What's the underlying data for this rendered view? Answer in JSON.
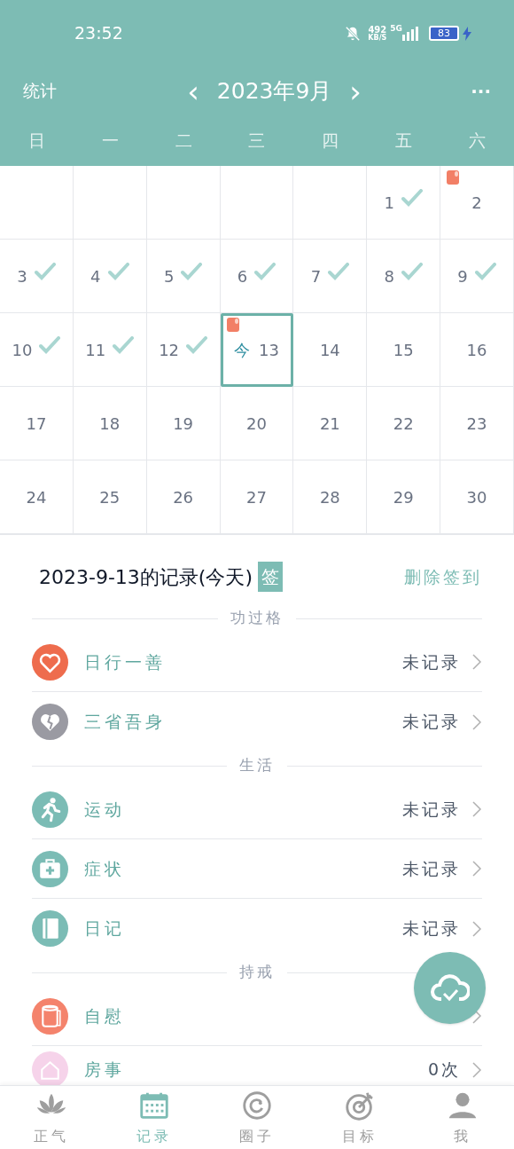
{
  "status_bar": {
    "time": "23:52",
    "speed": "492",
    "speed_unit": "KB/S",
    "network": "5G",
    "battery": "83"
  },
  "header": {
    "left": "统计",
    "prev": "‹",
    "title": "2023年9月",
    "next": "›",
    "more": "···"
  },
  "weekdays": [
    "日",
    "一",
    "二",
    "三",
    "四",
    "五",
    "六"
  ],
  "calendar": {
    "weeks": [
      [
        {
          "kind": "blank"
        },
        {
          "kind": "blank"
        },
        {
          "kind": "blank"
        },
        {
          "kind": "blank"
        },
        {
          "kind": "blank"
        },
        {
          "kind": "day",
          "day": "1",
          "checked": true,
          "marker": false,
          "selected": false
        },
        {
          "kind": "day",
          "day": "2",
          "checked": false,
          "marker": true,
          "selected": false
        }
      ],
      [
        {
          "kind": "day",
          "day": "3",
          "checked": true,
          "marker": false,
          "selected": false
        },
        {
          "kind": "day",
          "day": "4",
          "checked": true,
          "marker": false,
          "selected": false
        },
        {
          "kind": "day",
          "day": "5",
          "checked": true,
          "marker": false,
          "selected": false
        },
        {
          "kind": "day",
          "day": "6",
          "checked": true,
          "marker": false,
          "selected": false
        },
        {
          "kind": "day",
          "day": "7",
          "checked": true,
          "marker": false,
          "selected": false
        },
        {
          "kind": "day",
          "day": "8",
          "checked": true,
          "marker": false,
          "selected": false
        },
        {
          "kind": "day",
          "day": "9",
          "checked": true,
          "marker": false,
          "selected": false
        }
      ],
      [
        {
          "kind": "day",
          "day": "10",
          "checked": true,
          "marker": false,
          "selected": false
        },
        {
          "kind": "day",
          "day": "11",
          "checked": true,
          "marker": false,
          "selected": false
        },
        {
          "kind": "day",
          "day": "12",
          "checked": true,
          "marker": false,
          "selected": false
        },
        {
          "kind": "day",
          "day": "13",
          "checked": false,
          "marker": true,
          "selected": true,
          "today_label": "今"
        },
        {
          "kind": "day",
          "day": "14",
          "checked": false,
          "marker": false,
          "selected": false
        },
        {
          "kind": "day",
          "day": "15",
          "checked": false,
          "marker": false,
          "selected": false
        },
        {
          "kind": "day",
          "day": "16",
          "checked": false,
          "marker": false,
          "selected": false
        }
      ],
      [
        {
          "kind": "day",
          "day": "17",
          "checked": false,
          "marker": false,
          "selected": false
        },
        {
          "kind": "day",
          "day": "18",
          "checked": false,
          "marker": false,
          "selected": false
        },
        {
          "kind": "day",
          "day": "19",
          "checked": false,
          "marker": false,
          "selected": false
        },
        {
          "kind": "day",
          "day": "20",
          "checked": false,
          "marker": false,
          "selected": false
        },
        {
          "kind": "day",
          "day": "21",
          "checked": false,
          "marker": false,
          "selected": false
        },
        {
          "kind": "day",
          "day": "22",
          "checked": false,
          "marker": false,
          "selected": false
        },
        {
          "kind": "day",
          "day": "23",
          "checked": false,
          "marker": false,
          "selected": false
        }
      ],
      [
        {
          "kind": "day",
          "day": "24",
          "checked": false,
          "marker": false,
          "selected": false
        },
        {
          "kind": "day",
          "day": "25",
          "checked": false,
          "marker": false,
          "selected": false
        },
        {
          "kind": "day",
          "day": "26",
          "checked": false,
          "marker": false,
          "selected": false
        },
        {
          "kind": "day",
          "day": "27",
          "checked": false,
          "marker": false,
          "selected": false
        },
        {
          "kind": "day",
          "day": "28",
          "checked": false,
          "marker": false,
          "selected": false
        },
        {
          "kind": "day",
          "day": "29",
          "checked": false,
          "marker": false,
          "selected": false
        },
        {
          "kind": "day",
          "day": "30",
          "checked": false,
          "marker": false,
          "selected": false
        }
      ]
    ]
  },
  "record": {
    "title": "2023-9-13的记录(今天)",
    "badge": "签",
    "action": "删除签到"
  },
  "sections": [
    {
      "title": "功过格",
      "items": [
        {
          "kind": "heart",
          "label": "日行一善",
          "value": "未记录",
          "color": "#ee6c4d"
        },
        {
          "kind": "broken-heart",
          "label": "三省吾身",
          "value": "未记录",
          "color": "#9a9aa2"
        }
      ]
    },
    {
      "title": "生活",
      "items": [
        {
          "kind": "runner",
          "label": "运动",
          "value": "未记录",
          "color": "#7bbcb5"
        },
        {
          "kind": "medkit",
          "label": "症状",
          "value": "未记录",
          "color": "#7bbcb5"
        },
        {
          "kind": "book",
          "label": "日记",
          "value": "未记录",
          "color": "#7bbcb5"
        }
      ]
    },
    {
      "title": "持戒",
      "items": [
        {
          "kind": "roll",
          "label": "自慰",
          "color": "#f4836c"
        },
        {
          "kind": "house",
          "label": "房事",
          "value": "0次",
          "color": "#f6d3ea"
        }
      ]
    }
  ],
  "nav": [
    {
      "kind": "lotus",
      "label": "正气",
      "selected": false
    },
    {
      "kind": "calendar",
      "label": "记录",
      "selected": true
    },
    {
      "kind": "ring",
      "label": "圈子",
      "selected": false
    },
    {
      "kind": "target",
      "label": "目标",
      "selected": false
    },
    {
      "kind": "person",
      "label": "我",
      "selected": false
    }
  ]
}
